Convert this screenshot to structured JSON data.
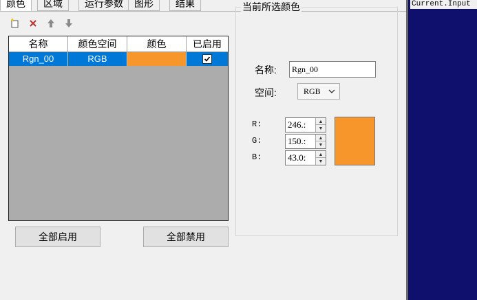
{
  "tabs": [
    {
      "label": "颜色",
      "active": true
    },
    {
      "label": "区域"
    },
    {
      "label": "运行参数"
    },
    {
      "label": "图形"
    },
    {
      "label": "结果"
    }
  ],
  "toolbar": {
    "icons": [
      "new-item-icon",
      "delete-icon",
      "move-up-icon",
      "move-down-icon"
    ]
  },
  "grid": {
    "columns": [
      "名称",
      "颜色空间",
      "颜色",
      "已启用"
    ],
    "rows": [
      {
        "name": "Rgn_00",
        "space": "RGB",
        "color": "#f6962b",
        "enabled": true
      }
    ]
  },
  "buttons": {
    "enable_all": "全部启用",
    "disable_all": "全部禁用"
  },
  "selected_color": {
    "group_title": "当前所选颜色",
    "name_label": "名称:",
    "name_value": "Rgn_00",
    "space_label": "空间:",
    "space_value": "RGB",
    "r_label": "R:",
    "g_label": "G:",
    "b_label": "B:",
    "r_value": "246.:",
    "g_value": "150.:",
    "b_value": "43.0:",
    "preview_color": "#f6962b"
  },
  "right_panel": {
    "title": "Current.Input"
  }
}
